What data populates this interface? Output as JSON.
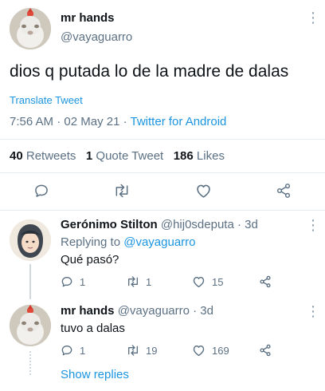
{
  "main_tweet": {
    "display_name": "mr hands",
    "handle": "@vayaguarro",
    "text": "dios q putada lo de la madre de dalas",
    "translate_label": "Translate Tweet",
    "time": "7:56 AM",
    "date": "02 May 21",
    "separator": "·",
    "client": "Twitter for Android",
    "stats": {
      "retweets_count": "40",
      "retweets_label": "Retweets",
      "quotes_count": "1",
      "quotes_label": "Quote Tweet",
      "likes_count": "186",
      "likes_label": "Likes"
    },
    "icons": [
      "reply-icon",
      "retweet-icon",
      "like-icon",
      "share-icon"
    ]
  },
  "replies": [
    {
      "display_name": "Gerónimo Stilton",
      "handle": "@hij0sdeputa",
      "age": "· 3d",
      "replying_prefix": "Replying to",
      "replying_handle": "@vayaguarro",
      "text": "Qué pasó?",
      "reply_count": "1",
      "retweet_count": "1",
      "like_count": "15"
    },
    {
      "display_name": "mr hands",
      "handle": "@vayaguarro",
      "age": "· 3d",
      "text": "tuvo a dalas",
      "reply_count": "1",
      "retweet_count": "19",
      "like_count": "169"
    }
  ],
  "show_replies_label": "Show replies",
  "colors": {
    "accent": "#1b95e0",
    "muted": "#5b7083",
    "divider": "#e6ecf0"
  }
}
